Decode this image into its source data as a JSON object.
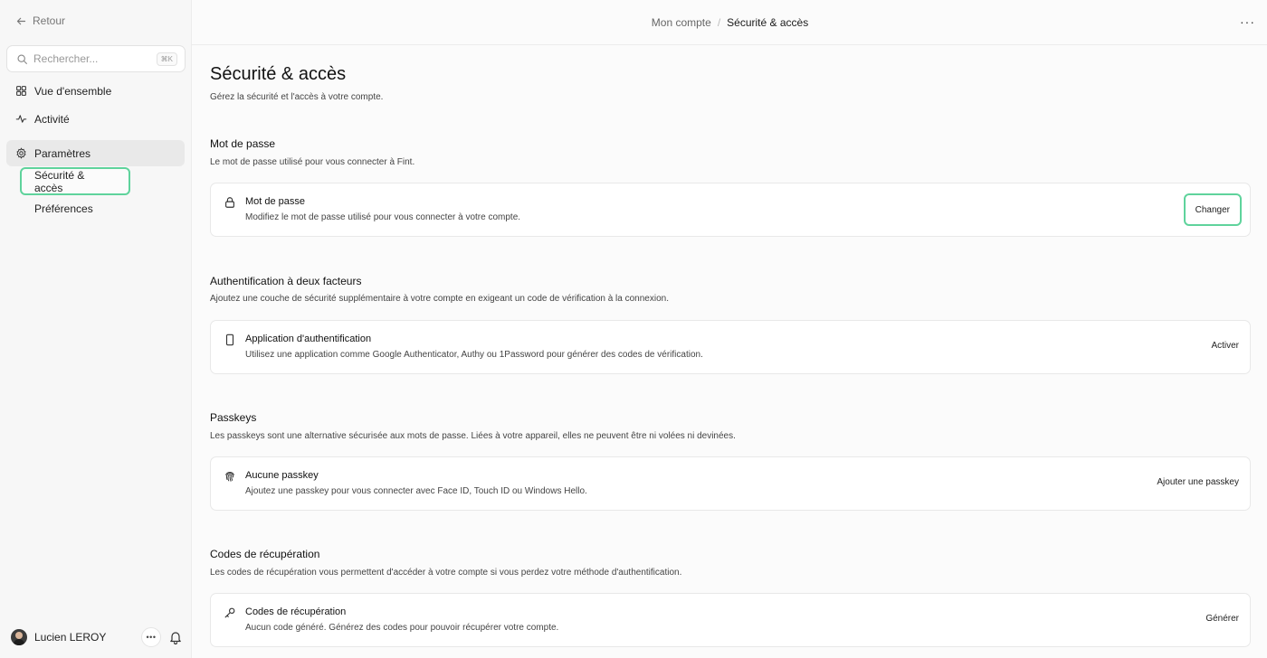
{
  "sidebar": {
    "back_label": "Retour",
    "search": {
      "placeholder": "Rechercher...",
      "shortcut": "⌘K"
    },
    "items": [
      {
        "label": "Vue d'ensemble",
        "icon": "grid-icon"
      },
      {
        "label": "Activité",
        "icon": "activity-icon"
      },
      {
        "label": "Paramètres",
        "icon": "gear-icon"
      }
    ],
    "sub_items": [
      {
        "label": "Sécurité & accès"
      },
      {
        "label": "Préférences"
      }
    ],
    "user": {
      "name": "Lucien LEROY"
    }
  },
  "header": {
    "breadcrumb_parent": "Mon compte",
    "breadcrumb_sep": "/",
    "breadcrumb_current": "Sécurité & accès",
    "more": "···"
  },
  "page": {
    "title": "Sécurité & accès",
    "description": "Gérez la sécurité et l'accès à votre compte."
  },
  "sections": [
    {
      "title": "Mot de passe",
      "description": "Le mot de passe utilisé pour vous connecter à Fint.",
      "card": {
        "icon": "lock-icon",
        "title": "Mot de passe",
        "description": "Modifiez le mot de passe utilisé pour vous connecter à votre compte.",
        "action": "Changer"
      }
    },
    {
      "title": "Authentification à deux facteurs",
      "description": "Ajoutez une couche de sécurité supplémentaire à votre compte en exigeant un code de vérification à la connexion.",
      "card": {
        "icon": "phone-icon",
        "title": "Application d'authentification",
        "description": "Utilisez une application comme Google Authenticator, Authy ou 1Password pour générer des codes de vérification.",
        "action": "Activer"
      }
    },
    {
      "title": "Passkeys",
      "description": "Les passkeys sont une alternative sécurisée aux mots de passe. Liées à votre appareil, elles ne peuvent être ni volées ni devinées.",
      "card": {
        "icon": "fingerprint-icon",
        "title": "Aucune passkey",
        "description": "Ajoutez une passkey pour vous connecter avec Face ID, Touch ID ou Windows Hello.",
        "action": "Ajouter une passkey"
      }
    },
    {
      "title": "Codes de récupération",
      "description": "Les codes de récupération vous permettent d'accéder à votre compte si vous perdez votre méthode d'authentification.",
      "card": {
        "icon": "key-icon",
        "title": "Codes de récupération",
        "description": "Aucun code généré. Générez des codes pour pouvoir récupérer votre compte.",
        "action": "Générer"
      }
    }
  ],
  "colors": {
    "accent_highlight": "#5fd39c",
    "sidebar_bg": "#f7f7f7",
    "main_bg": "#fbfbfb"
  }
}
